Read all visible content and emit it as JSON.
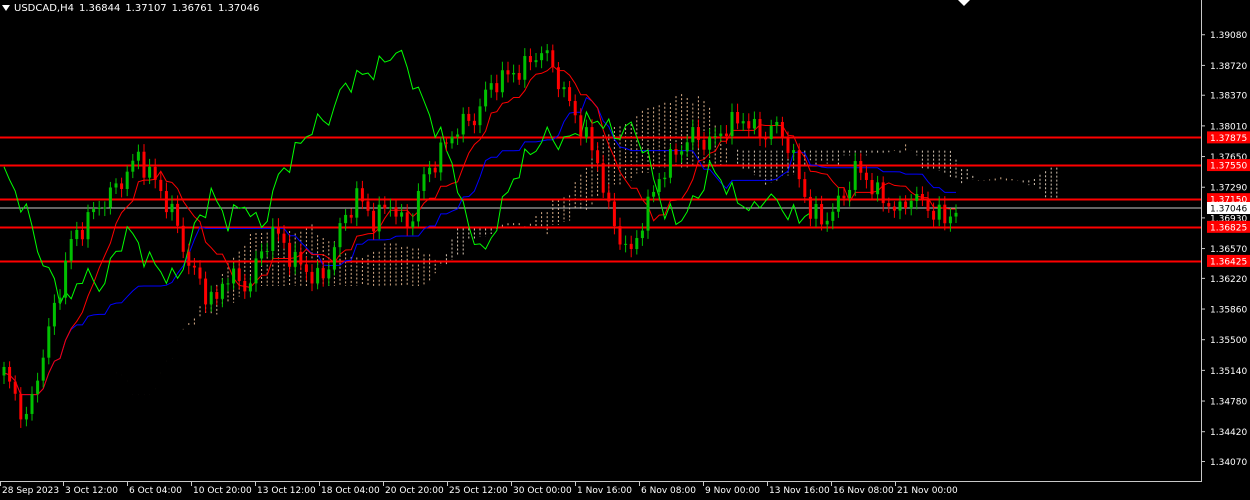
{
  "header": {
    "symbol": "USDCAD,H4",
    "open": "1.36844",
    "high": "1.37107",
    "low": "1.36761",
    "close": "1.37046"
  },
  "colors": {
    "background": "#000000",
    "axis": "#c8c8c8",
    "text": "#ffffff",
    "bull": "#00c000",
    "bear": "#ff0000",
    "kijun": "#0000ff",
    "tenkan": "#ff0000",
    "chikou": "#00ff00",
    "cloud_bull": "#f2c49a",
    "cloud_bear": "#eedcc8",
    "level": "#ff0000"
  },
  "chart_data": {
    "type": "candlestick",
    "indicator": "ichimoku",
    "ylim": [
      1.339,
      1.393
    ],
    "y_ticks": [
      "1.39080",
      "1.38720",
      "1.38370",
      "1.38010",
      "1.37650",
      "1.37290",
      "1.36930",
      "1.36570",
      "1.36220",
      "1.35860",
      "1.35500",
      "1.35140",
      "1.34780",
      "1.34420",
      "1.34070"
    ],
    "x_ticks": [
      "28 Sep 2023",
      "3 Oct 12:00",
      "6 Oct 04:00",
      "10 Oct 20:00",
      "13 Oct 12:00",
      "18 Oct 04:00",
      "20 Oct 20:00",
      "25 Oct 12:00",
      "30 Oct 00:00",
      "1 Nov 16:00",
      "6 Nov 08:00",
      "9 Nov 00:00",
      "13 Nov 16:00",
      "16 Nov 08:00",
      "21 Nov 00:00"
    ],
    "current_price": "1.37046",
    "levels": [
      {
        "label": "1.37875",
        "value": 1.37875
      },
      {
        "label": "1.37550",
        "value": 1.3755
      },
      {
        "label": "1.37150",
        "value": 1.3715
      },
      {
        "label": "1.36825",
        "value": 1.36825
      },
      {
        "label": "1.36425",
        "value": 1.36425
      }
    ],
    "close_path": [
      [
        0,
        1.3512
      ],
      [
        4,
        1.3455
      ],
      [
        8,
        1.356
      ],
      [
        12,
        1.3665
      ],
      [
        16,
        1.37
      ],
      [
        20,
        1.3728
      ],
      [
        24,
        1.3765
      ],
      [
        27,
        1.3735
      ],
      [
        30,
        1.37
      ],
      [
        33,
        1.364
      ],
      [
        36,
        1.3605
      ],
      [
        38,
        1.3595
      ],
      [
        40,
        1.363
      ],
      [
        43,
        1.361
      ],
      [
        46,
        1.365
      ],
      [
        48,
        1.368
      ],
      [
        51,
        1.365
      ],
      [
        54,
        1.363
      ],
      [
        57,
        1.362
      ],
      [
        60,
        1.368
      ],
      [
        63,
        1.372
      ],
      [
        66,
        1.369
      ],
      [
        69,
        1.371
      ],
      [
        72,
        1.368
      ],
      [
        75,
        1.374
      ],
      [
        78,
        1.377
      ],
      [
        81,
        1.38
      ],
      [
        84,
        1.381
      ],
      [
        87,
        1.385
      ],
      [
        90,
        1.386
      ],
      [
        93,
        1.387
      ],
      [
        96,
        1.389
      ],
      [
        98,
        1.387
      ],
      [
        100,
        1.384
      ],
      [
        103,
        1.38
      ],
      [
        106,
        1.376
      ],
      [
        108,
        1.37
      ],
      [
        110,
        1.367
      ],
      [
        112,
        1.365
      ],
      [
        114,
        1.369
      ],
      [
        117,
        1.374
      ],
      [
        120,
        1.377
      ],
      [
        123,
        1.379
      ],
      [
        126,
        1.378
      ],
      [
        129,
        1.38
      ],
      [
        132,
        1.381
      ],
      [
        135,
        1.379
      ],
      [
        138,
        1.38
      ],
      [
        140,
        1.378
      ],
      [
        142,
        1.374
      ],
      [
        144,
        1.37
      ],
      [
        146,
        1.369
      ],
      [
        148,
        1.37
      ],
      [
        150,
        1.372
      ],
      [
        152,
        1.375
      ],
      [
        154,
        1.374
      ],
      [
        156,
        1.372
      ],
      [
        158,
        1.371
      ],
      [
        160,
        1.37
      ],
      [
        162,
        1.372
      ],
      [
        164,
        1.371
      ],
      [
        166,
        1.37
      ],
      [
        168,
        1.369
      ],
      [
        170,
        1.3705
      ]
    ]
  }
}
